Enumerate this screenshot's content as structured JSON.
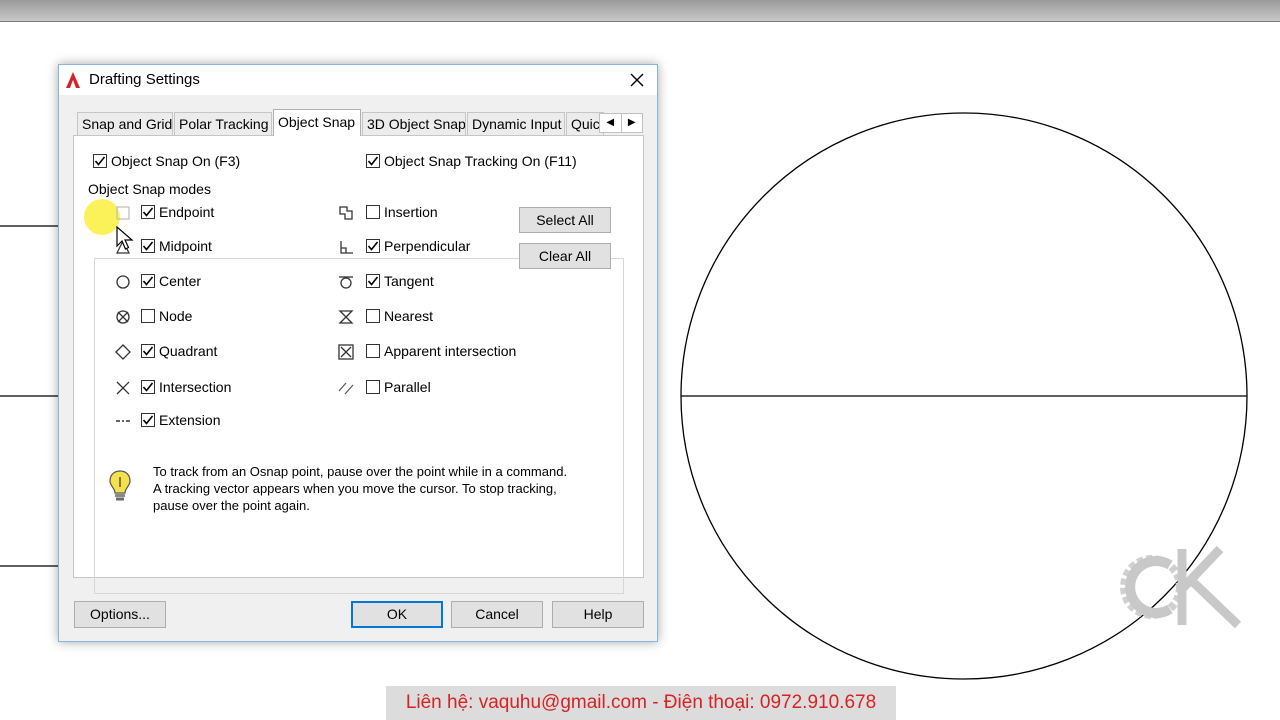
{
  "dialog": {
    "title": "Drafting Settings",
    "tabs": [
      "Snap and Grid",
      "Polar Tracking",
      "Object Snap",
      "3D Object Snap",
      "Dynamic Input",
      "Quic"
    ],
    "active_tab": "Object Snap",
    "object_snap_on": {
      "label": "Object Snap On (F3)",
      "checked": true
    },
    "object_snap_tracking_on": {
      "label": "Object Snap Tracking On (F11)",
      "checked": true
    },
    "modes_title": "Object Snap modes",
    "modes_left": [
      {
        "label": "Endpoint",
        "checked": true,
        "icon": "endpoint-icon"
      },
      {
        "label": "Midpoint",
        "checked": true,
        "icon": "midpoint-icon"
      },
      {
        "label": "Center",
        "checked": true,
        "icon": "center-icon"
      },
      {
        "label": "Node",
        "checked": false,
        "icon": "node-icon"
      },
      {
        "label": "Quadrant",
        "checked": true,
        "icon": "quadrant-icon"
      },
      {
        "label": "Intersection",
        "checked": true,
        "icon": "intersection-icon"
      },
      {
        "label": "Extension",
        "checked": true,
        "icon": "extension-icon"
      }
    ],
    "modes_right": [
      {
        "label": "Insertion",
        "checked": false,
        "icon": "insertion-icon"
      },
      {
        "label": "Perpendicular",
        "checked": true,
        "icon": "perpendicular-icon"
      },
      {
        "label": "Tangent",
        "checked": true,
        "icon": "tangent-icon"
      },
      {
        "label": "Nearest",
        "checked": false,
        "icon": "nearest-icon"
      },
      {
        "label": "Apparent intersection",
        "checked": false,
        "icon": "apparent-intersection-icon"
      },
      {
        "label": "Parallel",
        "checked": false,
        "icon": "parallel-icon"
      }
    ],
    "select_all": "Select All",
    "clear_all": "Clear All",
    "tip": "To track from an Osnap point, pause over the point while in a command.  A tracking vector appears when you move the cursor. To stop tracking, pause over the point again.",
    "buttons": {
      "options": "Options...",
      "ok": "OK",
      "cancel": "Cancel",
      "help": "Help"
    }
  },
  "contact": "Liên hệ: vaquhu@gmail.com - Điện thoại: 0972.910.678",
  "colors": {
    "accent": "#0078d7",
    "contact_text": "#d62222",
    "highlight": "#faf03c"
  }
}
